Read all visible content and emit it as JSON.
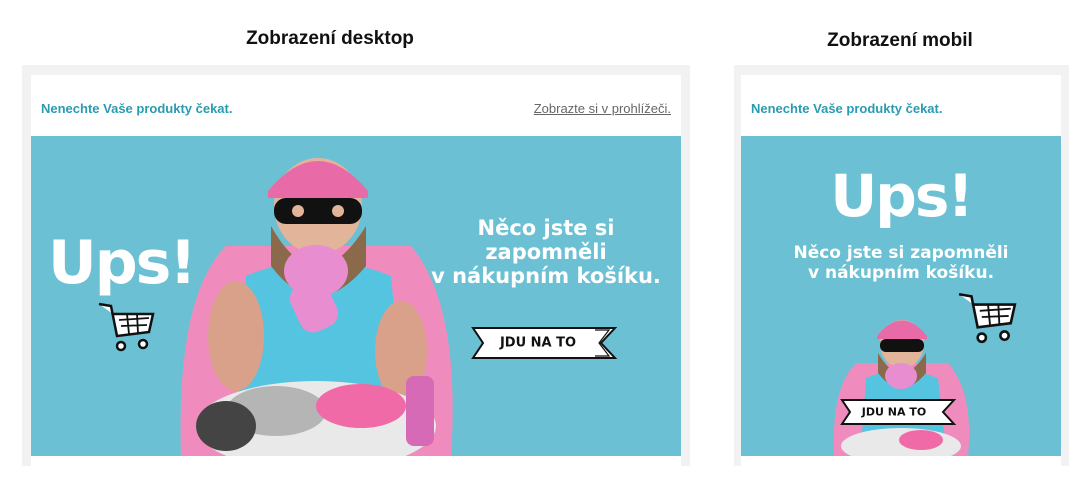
{
  "desktop": {
    "heading": "Zobrazení desktop",
    "preheader": "Nenechte Vaše produkty čekat.",
    "browser_link": "Zobrazte si v prohlížeči.",
    "ups": "Ups!",
    "headline_lines": [
      "Něco jste si",
      "zapomněli",
      "v nákupním košíku."
    ],
    "cta_label": "JDU NA TO"
  },
  "mobile": {
    "heading": "Zobrazení mobil",
    "preheader": "Nenechte Vaše produkty čekat.",
    "ups": "Ups!",
    "headline_lines": [
      "Něco jste si zapomněli",
      "v nákupním košíku."
    ],
    "cta_label": "JDU NA TO"
  },
  "colors": {
    "banner_bg": "#6cc0d4",
    "preheader_text": "#2a9bb0",
    "frame_bg": "#f2f2f2",
    "helmet_pink": "#e86aa6",
    "cape_pink": "#f08cbd",
    "shirt_blue": "#55c4e0"
  },
  "icons": [
    "shopping-cart-icon",
    "ribbon-banner-icon"
  ]
}
